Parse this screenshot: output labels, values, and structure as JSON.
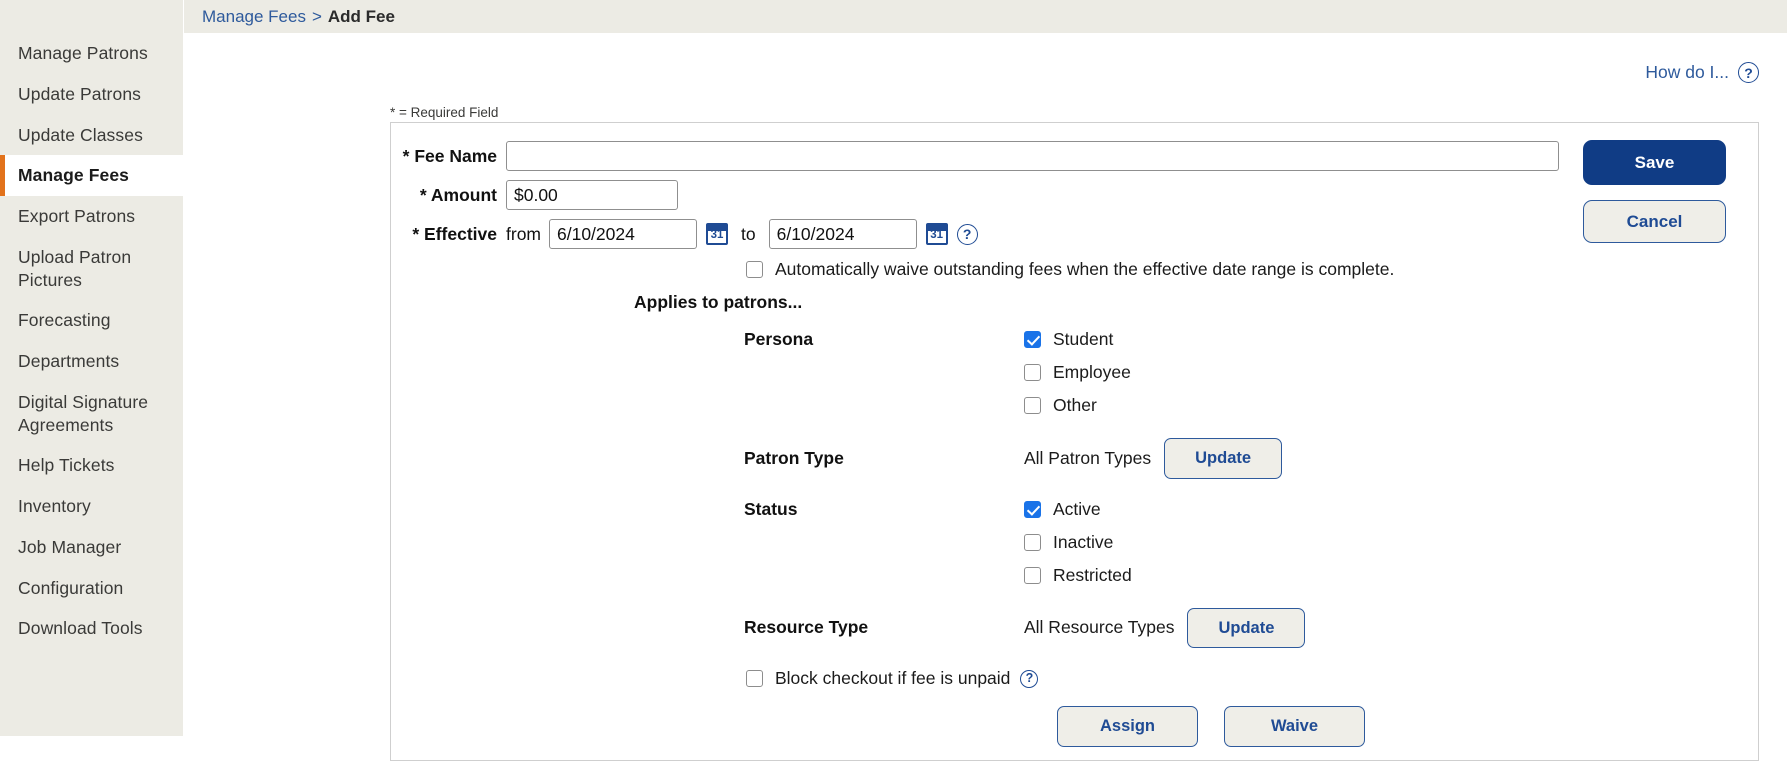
{
  "sidebar": {
    "items": [
      {
        "label": "Manage Patrons",
        "active": false
      },
      {
        "label": "Update Patrons",
        "active": false
      },
      {
        "label": "Update Classes",
        "active": false
      },
      {
        "label": "Manage Fees",
        "active": true
      },
      {
        "label": "Export Patrons",
        "active": false
      },
      {
        "label": "Upload Patron Pictures",
        "active": false
      },
      {
        "label": "Forecasting",
        "active": false
      },
      {
        "label": "Departments",
        "active": false
      },
      {
        "label": "Digital Signature Agreements",
        "active": false
      },
      {
        "label": "Help Tickets",
        "active": false
      },
      {
        "label": "Inventory",
        "active": false
      },
      {
        "label": "Job Manager",
        "active": false
      },
      {
        "label": "Configuration",
        "active": false
      },
      {
        "label": "Download Tools",
        "active": false
      }
    ]
  },
  "breadcrumb": {
    "parent": "Manage Fees",
    "separator": ">",
    "current": "Add Fee"
  },
  "help": {
    "how_do_i": "How do I...",
    "question_glyph": "?",
    "icon_name": "question-circle-icon"
  },
  "form": {
    "required_note": "* = Required Field",
    "fee_name": {
      "label": "* Fee Name",
      "value": "",
      "placeholder": ""
    },
    "amount": {
      "label": "* Amount",
      "value": "$0.00"
    },
    "effective": {
      "label": "* Effective",
      "from_label": "from",
      "from_value": "6/10/2024",
      "to_label": "to",
      "to_value": "6/10/2024",
      "calendar_glyph": "31",
      "calendar_icon_name": "calendar-icon"
    },
    "auto_waive": {
      "label": "Automatically waive outstanding fees when the effective date range is complete.",
      "checked": false
    },
    "applies_to_title": "Applies to patrons...",
    "persona": {
      "label": "Persona",
      "options": [
        {
          "label": "Student",
          "checked": true
        },
        {
          "label": "Employee",
          "checked": false
        },
        {
          "label": "Other",
          "checked": false
        }
      ]
    },
    "patron_type": {
      "label": "Patron Type",
      "value": "All Patron Types",
      "button": "Update"
    },
    "status": {
      "label": "Status",
      "options": [
        {
          "label": "Active",
          "checked": true
        },
        {
          "label": "Inactive",
          "checked": false
        },
        {
          "label": "Restricted",
          "checked": false
        }
      ]
    },
    "resource_type": {
      "label": "Resource Type",
      "value": "All Resource Types",
      "button": "Update"
    },
    "block_checkout": {
      "label": "Block checkout if fee is unpaid",
      "checked": false
    },
    "assign_button": "Assign",
    "waive_button": "Waive"
  },
  "actions": {
    "save": "Save",
    "cancel": "Cancel"
  },
  "colors": {
    "accent_orange": "#E2721B",
    "link_blue": "#2E5A9C",
    "primary_blue": "#103C85",
    "checkbox_blue": "#1A73E8",
    "sidebar_bg": "#ECEBE4"
  }
}
